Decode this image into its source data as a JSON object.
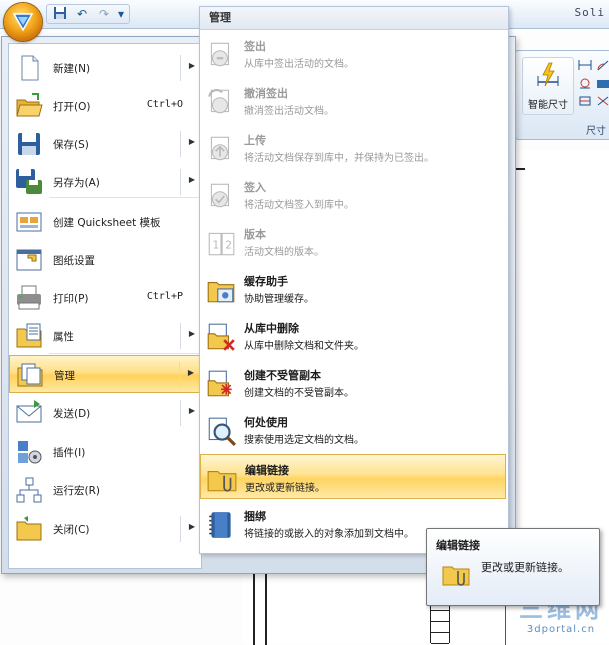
{
  "app": {
    "title": "Soli"
  },
  "quick_access": {
    "buttons": [
      {
        "name": "save-icon",
        "glyph": "💾"
      },
      {
        "name": "undo-icon",
        "glyph": "↶"
      },
      {
        "name": "redo-icon",
        "glyph": "↷"
      },
      {
        "name": "dropdown-icon",
        "glyph": "▾"
      }
    ]
  },
  "ribbon": {
    "smart_dimension_label": "智能尺寸",
    "group_label": "尺寸"
  },
  "menu": {
    "items": [
      {
        "label": "新建(N)",
        "shortcut": "",
        "arrow": true,
        "icon": "new-document-icon"
      },
      {
        "label": "打开(O)",
        "shortcut": "Ctrl+O",
        "arrow": false,
        "icon": "open-folder-icon"
      },
      {
        "label": "保存(S)",
        "shortcut": "",
        "arrow": true,
        "icon": "save-icon"
      },
      {
        "label": "另存为(A)",
        "shortcut": "",
        "arrow": true,
        "icon": "save-as-icon"
      },
      {
        "label": "创建 Quicksheet 模板",
        "shortcut": "",
        "arrow": false,
        "icon": "quicksheet-icon"
      },
      {
        "label": "图纸设置",
        "shortcut": "",
        "arrow": false,
        "icon": "sheet-setup-icon"
      },
      {
        "label": "打印(P)",
        "shortcut": "Ctrl+P",
        "arrow": false,
        "icon": "printer-icon"
      },
      {
        "label": "属性",
        "shortcut": "",
        "arrow": true,
        "icon": "properties-icon"
      },
      {
        "label": "管理",
        "shortcut": "",
        "arrow": true,
        "icon": "manage-icon",
        "active": true
      },
      {
        "label": "发送(D)",
        "shortcut": "",
        "arrow": true,
        "icon": "send-mail-icon"
      },
      {
        "label": "插件(I)",
        "shortcut": "",
        "arrow": false,
        "icon": "addin-icon"
      },
      {
        "label": "运行宏(R)",
        "shortcut": "",
        "arrow": false,
        "icon": "run-macro-icon"
      },
      {
        "label": "关闭(C)",
        "shortcut": "",
        "arrow": true,
        "icon": "close-folder-icon"
      }
    ]
  },
  "submenu": {
    "header": "管理",
    "items": [
      {
        "title": "签出",
        "desc": "从库中签出活动的文档。",
        "disabled": true,
        "icon": "check-out-icon"
      },
      {
        "title": "撤消签出",
        "desc": "撤消签出活动文档。",
        "disabled": true,
        "icon": "undo-check-out-icon"
      },
      {
        "title": "上传",
        "desc": "将活动文档保存到库中，并保持为已签出。",
        "disabled": true,
        "icon": "upload-icon"
      },
      {
        "title": "签入",
        "desc": "将活动文档签入到库中。",
        "disabled": true,
        "icon": "check-in-icon"
      },
      {
        "title": "版本",
        "desc": "活动文档的版本。",
        "disabled": true,
        "icon": "version-icon"
      },
      {
        "title": "缓存助手",
        "desc": "协助管理缓存。",
        "disabled": false,
        "icon": "cache-assistant-icon"
      },
      {
        "title": "从库中删除",
        "desc": "从库中删除文档和文件夹。",
        "disabled": false,
        "icon": "delete-from-library-icon"
      },
      {
        "title": "创建不受管副本",
        "desc": "创建文档的不受管副本。",
        "disabled": false,
        "icon": "unmanaged-copy-icon"
      },
      {
        "title": "何处使用",
        "desc": "搜索使用选定文档的文档。",
        "disabled": false,
        "icon": "where-used-icon"
      },
      {
        "title": "编辑链接",
        "desc": "更改或更新链接。",
        "disabled": false,
        "icon": "edit-links-icon",
        "active": true
      },
      {
        "title": "捆绑",
        "desc": "将链接的或嵌入的对象添加到文档中。",
        "disabled": false,
        "icon": "bundle-icon"
      }
    ]
  },
  "tooltip": {
    "title": "编辑链接",
    "desc": "更改或更新链接。"
  },
  "watermark": {
    "line1": "三维网",
    "line2": "3dportal.cn"
  }
}
